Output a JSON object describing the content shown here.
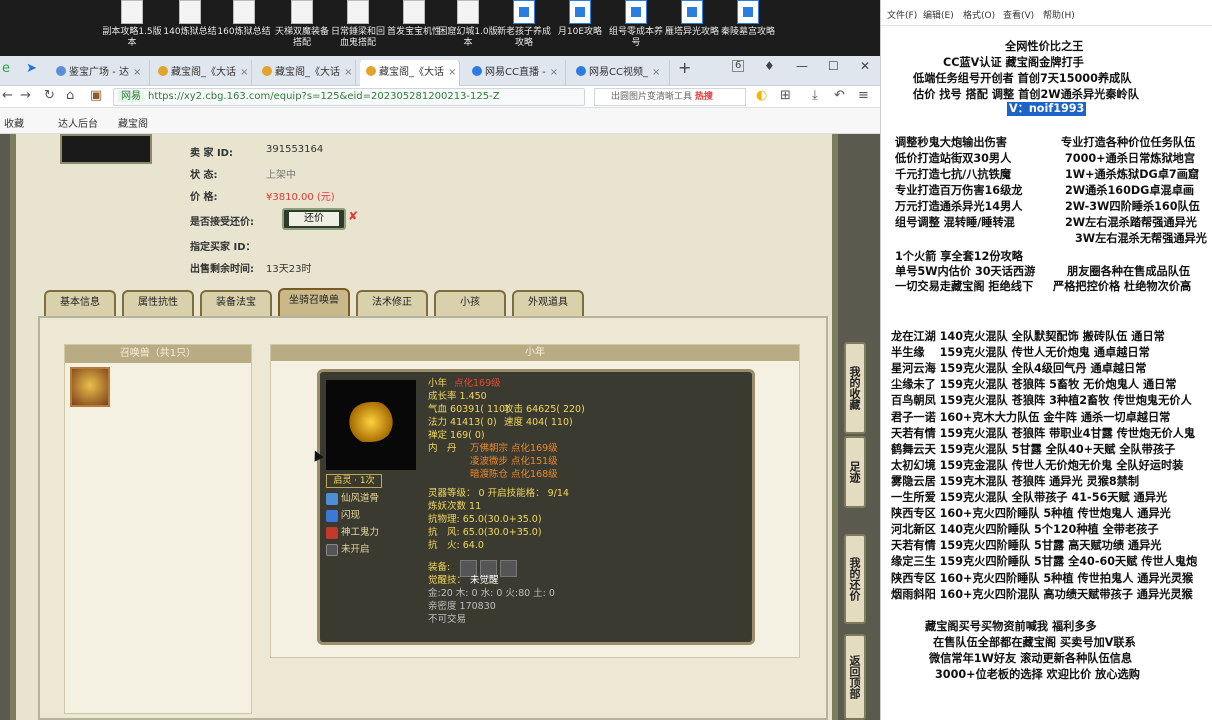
{
  "desktop": {
    "icons": [
      "副本攻略1.5版本",
      "140炼狱总结",
      "160炼狱总结",
      "天梯双魔装备搭配",
      "日常錘梁和回血鬼搭配",
      "首发宝宝机性",
      "困窟幻城1.0版本",
      "新老孩子养成攻略",
      "月10E攻略",
      "组号零成本养号",
      "雁塔异光攻略",
      "秦陵墓宫攻略"
    ]
  },
  "browser": {
    "tabs": [
      {
        "label": "鉴宝广场 - 达",
        "color": "#5a8fd8"
      },
      {
        "label": "藏宝阁_《大话",
        "color": "#e0a52a"
      },
      {
        "label": "藏宝阁_《大话",
        "color": "#e0a52a"
      },
      {
        "label": "藏宝阁_《大话",
        "color": "#e0a52a"
      },
      {
        "label": "网易CC直播 -",
        "color": "#2c7be5"
      },
      {
        "label": "网易CC视频_",
        "color": "#2c7be5"
      }
    ],
    "tab_count_badge": "6",
    "url_site": "网易",
    "url": "https://xy2.cbg.163.com/equip?s=125&eid=202305281200213-125-Z",
    "search_text": "出圆图片变清晰工具",
    "search_hot": "热搜",
    "bookmarks": [
      "收藏",
      "达人后台",
      "藏宝阁"
    ]
  },
  "game": {
    "seller_id_label": "卖 家 ID:",
    "seller_id": "391553164",
    "status_label": "状 态:",
    "status": "上架中",
    "price_label": "价 格:",
    "price": "¥3810.00 (元)",
    "counter_label": "是否接受还价:",
    "counter_btn": "还价",
    "buyer_label": "指定买家 ID：",
    "time_label": "出售剩余时间:",
    "time_value": "13天23时",
    "tabs": [
      "基本信息",
      "属性抗性",
      "装备法宝",
      "坐骑召唤兽",
      "法术修正",
      "小孩",
      "外观道具"
    ],
    "pet_panel_title": "召唤兽（共1只）",
    "detail_title": "小年",
    "detail": {
      "name": "小年",
      "dianhua": "点化169级",
      "growth": "成长率 1.450",
      "hp": "气血 60391( 110)",
      "atk": "攻击 64625( 220)",
      "mp": "法力 41413( 0)",
      "spd": "速度 404( 110)",
      "zen": "禅定 169( 0)",
      "neidan_label": "内　丹",
      "neidan": [
        "万佛朝宗 点化169级",
        "凌波微步 点化151级",
        "暗渡陈仓 点化168级"
      ],
      "lingxing": "灵器等级： 0 开启技能格： 9/14",
      "lianyao": "炼妖次数 11",
      "res1": "抗物理: 65.0(30.0+35.0)",
      "res2": "抗　风: 65.0(30.0+35.0)",
      "res3": "抗　火: 64.0",
      "equip_label": "装备:",
      "juexing_label": "觉醒技：",
      "juexing": "未觉醒",
      "elements": "金:20 木: 0 水: 0 火:80 土: 0",
      "intimacy": "亲密度 170830",
      "trade": "不可交易",
      "qiling_btn": "启灵 · 1次",
      "skills": [
        "仙风道骨",
        "闪现",
        "神工鬼力",
        "未开启"
      ]
    },
    "side_buttons": [
      "我的收藏",
      "足迹",
      "我的还价",
      "返回顶部"
    ]
  },
  "notepad": {
    "menu": [
      "文件(F)",
      "编辑(E)",
      "格式(O)",
      "查看(V)",
      "帮助(H)"
    ],
    "header": [
      "全网性价比之王",
      "CC蓝V认证 藏宝阁金牌打手",
      "低端任务组号开创者 首创7天15000养成队",
      "估价 找号 搭配 调整 首创2W通杀异光秦岭队"
    ],
    "vid": "V：noif1993",
    "services": [
      [
        "调整秒鬼大炮输出伤害",
        "专业打造各种价位任务队伍"
      ],
      [
        "低价打造站街双30男人",
        "7000+通杀日常炼狱地宫"
      ],
      [
        "千元打造七抗/八抗铁魔",
        "1W+通杀炼狱DG卓7画窟"
      ],
      [
        "专业打造百万伤害16级龙",
        "2W通杀160DG卓混卓画"
      ],
      [
        "万元打造通杀异光14男人",
        "2W-3W四阶睡杀160队伍"
      ],
      [
        "组号调整 混转睡/睡转混",
        "2W左右混杀踏帮强通异光"
      ],
      [
        "",
        "3W左右混杀无帮强通异光"
      ]
    ],
    "promo": [
      "1个火箭 享全套12份攻略",
      "单号5W内估价 30天话西游",
      "一切交易走藏宝阁 拒绝线下"
    ],
    "promo_right": [
      "",
      "朋友圈各种在售成品队伍",
      "严格把控价格 杜绝物次价高"
    ],
    "teams": [
      "龙在江湖 140克火混队 全队默契配饰 搬砖队伍 通日常",
      "半生缘　 159克火混队 传世人无价炮鬼 通卓越日常",
      "星河云海 159克火混队 全队4级回气丹 通卓越日常",
      "尘缘未了 159克火混队 苍狼阵 5畜牧 无价炮鬼人 通日常",
      "百鸟朝凤 159克火混队 苍狼阵 3种植2畜牧 传世炮鬼无价人",
      "君子一诺 160+克木大力队伍 金牛阵 通杀一切卓越日常",
      "天若有情 159克火混队 苍狼阵 带职业4甘露 传世炮无价人鬼",
      "鹤舞云天 159克火混队 5甘露 全队40+天赋 全队带孩子",
      "太初幻境 159克金混队 传世人无价炮无价鬼 全队好运时装",
      "雾隐云居 159克木混队 苍狼阵 通异光 灵猴8禁制",
      "一生所爱 159克火混队 全队带孩子 41-56天赋 通异光",
      "陕西专区 160+克火四阶睡队 5种植 传世炮鬼人 通异光",
      "河北新区 140克火四阶睡队 5个120种植 全带老孩子",
      "天若有情 159克火四阶睡队 5甘露 高天赋功绩 通异光",
      "缘定三生 159克火四阶睡队 5甘露 全40-60天赋 传世人鬼炮",
      "陕西专区 160+克火四阶睡队 5种植 传世拍鬼人 通异光灵猴",
      "烟雨斜阳 160+克火四阶混队 高功绩天赋带孩子 通异光灵猴"
    ],
    "footer": [
      "藏宝阁买号买物资前喊我 福利多多",
      "在售队伍全部都在藏宝阁 买卖号加V联系",
      "微信常年1W好友 滚动更新各种队伍信息",
      "3000+位老板的选择 欢迎比价 放心选购"
    ]
  }
}
